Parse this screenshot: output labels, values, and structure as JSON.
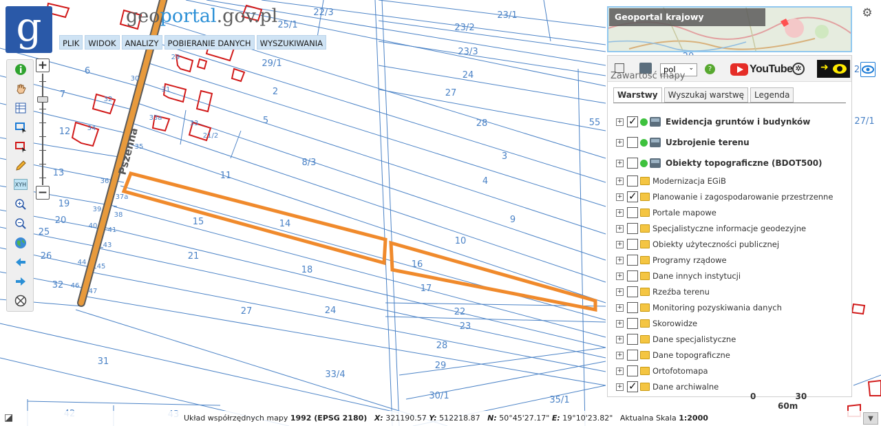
{
  "site": {
    "logo_letter": "g",
    "title_part1": "geo",
    "title_part2": "portal",
    "title_part3": ".gov.pl"
  },
  "menu": [
    "PLIK",
    "WIDOK",
    "ANALIZY",
    "POBIERANIE DANYCH",
    "WYSZUKIWANIA"
  ],
  "toolbar": {
    "tools": [
      "info-icon",
      "pan-hand-icon",
      "table-icon",
      "select-rectangle-icon",
      "select-polygon-icon",
      "pencil-icon",
      "xyh-icon",
      "zoom-in-icon",
      "zoom-out-icon",
      "globe-icon",
      "back-arrow-icon",
      "forward-arrow-icon",
      "clear-icon"
    ],
    "xyh_label": "XYH",
    "zoom_plus": "+",
    "zoom_minus": "−"
  },
  "overview": {
    "title": "Geoportal krajowy"
  },
  "panel": {
    "title": "Zawartość mapy",
    "language": "pol",
    "youtube_label": "YouTube",
    "tabs": [
      "Warstwy",
      "Wyszukaj warstwę",
      "Legenda"
    ],
    "layers": [
      {
        "label": "Ewidencja gruntów i budynków",
        "checked": true,
        "type": "wms",
        "bold": true
      },
      {
        "label": "Uzbrojenie terenu",
        "checked": false,
        "type": "wms",
        "bold": true
      },
      {
        "label": "Obiekty topograficzne (BDOT500)",
        "checked": false,
        "type": "wms",
        "bold": true
      },
      {
        "label": "Modernizacja EGiB",
        "checked": false,
        "type": "folder",
        "bold": false
      },
      {
        "label": "Planowanie i zagospodarowanie przestrzenne",
        "checked": true,
        "type": "folder",
        "bold": false
      },
      {
        "label": "Portale mapowe",
        "checked": false,
        "type": "folder",
        "bold": false
      },
      {
        "label": "Specjalistyczne informacje geodezyjne",
        "checked": false,
        "type": "folder",
        "bold": false
      },
      {
        "label": "Obiekty użyteczności publicznej",
        "checked": false,
        "type": "folder",
        "bold": false
      },
      {
        "label": "Programy rządowe",
        "checked": false,
        "type": "folder",
        "bold": false
      },
      {
        "label": "Dane innych instytucji",
        "checked": false,
        "type": "folder",
        "bold": false
      },
      {
        "label": "Rzeźba terenu",
        "checked": false,
        "type": "folder",
        "bold": false
      },
      {
        "label": "Monitoring pozyskiwania danych",
        "checked": false,
        "type": "folder",
        "bold": false
      },
      {
        "label": "Skorowidze",
        "checked": false,
        "type": "folder",
        "bold": false
      },
      {
        "label": "Dane specjalistyczne",
        "checked": false,
        "type": "folder",
        "bold": false
      },
      {
        "label": "Dane topograficzne",
        "checked": false,
        "type": "folder",
        "bold": false
      },
      {
        "label": "Ortofotomapa",
        "checked": false,
        "type": "folder",
        "bold": false
      },
      {
        "label": "Dane archiwalne",
        "checked": true,
        "type": "folder",
        "bold": false
      }
    ]
  },
  "map": {
    "street_name": "Pszenna",
    "plot_numbers": [
      "22/3",
      "23/1",
      "23/2",
      "23/3",
      "25/1",
      "6",
      "7",
      "29/1",
      "2",
      "24",
      "27",
      "12",
      "5",
      "28",
      "55",
      "27/1",
      "13",
      "11",
      "8/3",
      "3",
      "4",
      "19",
      "20",
      "15",
      "14",
      "9",
      "25",
      "10",
      "26",
      "21",
      "16",
      "18",
      "32",
      "17",
      "27",
      "24",
      "22",
      "23",
      "28",
      "33/4",
      "29",
      "31",
      "30/1",
      "35/1",
      "42",
      "43",
      "20",
      "2"
    ],
    "building_numbers": [
      "29",
      "30",
      "31",
      "32",
      "33a",
      "33",
      "34",
      "35",
      "36",
      "37a",
      "38",
      "39",
      "40",
      "41",
      "43",
      "44",
      "45",
      "46",
      "47",
      "21/2"
    ],
    "scale_labels": [
      "0",
      "30",
      "60m"
    ]
  },
  "status": {
    "coord_system_prefix": "Układ współrzędnych mapy",
    "coord_system": "1992 (EPSG 2180)",
    "x_label": "X:",
    "x_value": "321190.57",
    "y_label": "Y:",
    "y_value": "512218.87",
    "n_label": "N:",
    "n_value": "50°45'27.17\"",
    "e_label": "E:",
    "e_value": "19°10'23.82\"",
    "scale_prefix": "Aktualna Skala",
    "scale_value": "1:2000"
  },
  "colors": {
    "parcel_lines": "#4a82c6",
    "buildings": "#d11a1a",
    "highlight": "#f08a2c",
    "road": "#e89a3c",
    "logo_bg": "#2a59a8",
    "menu_bg": "#cfe3f4"
  }
}
